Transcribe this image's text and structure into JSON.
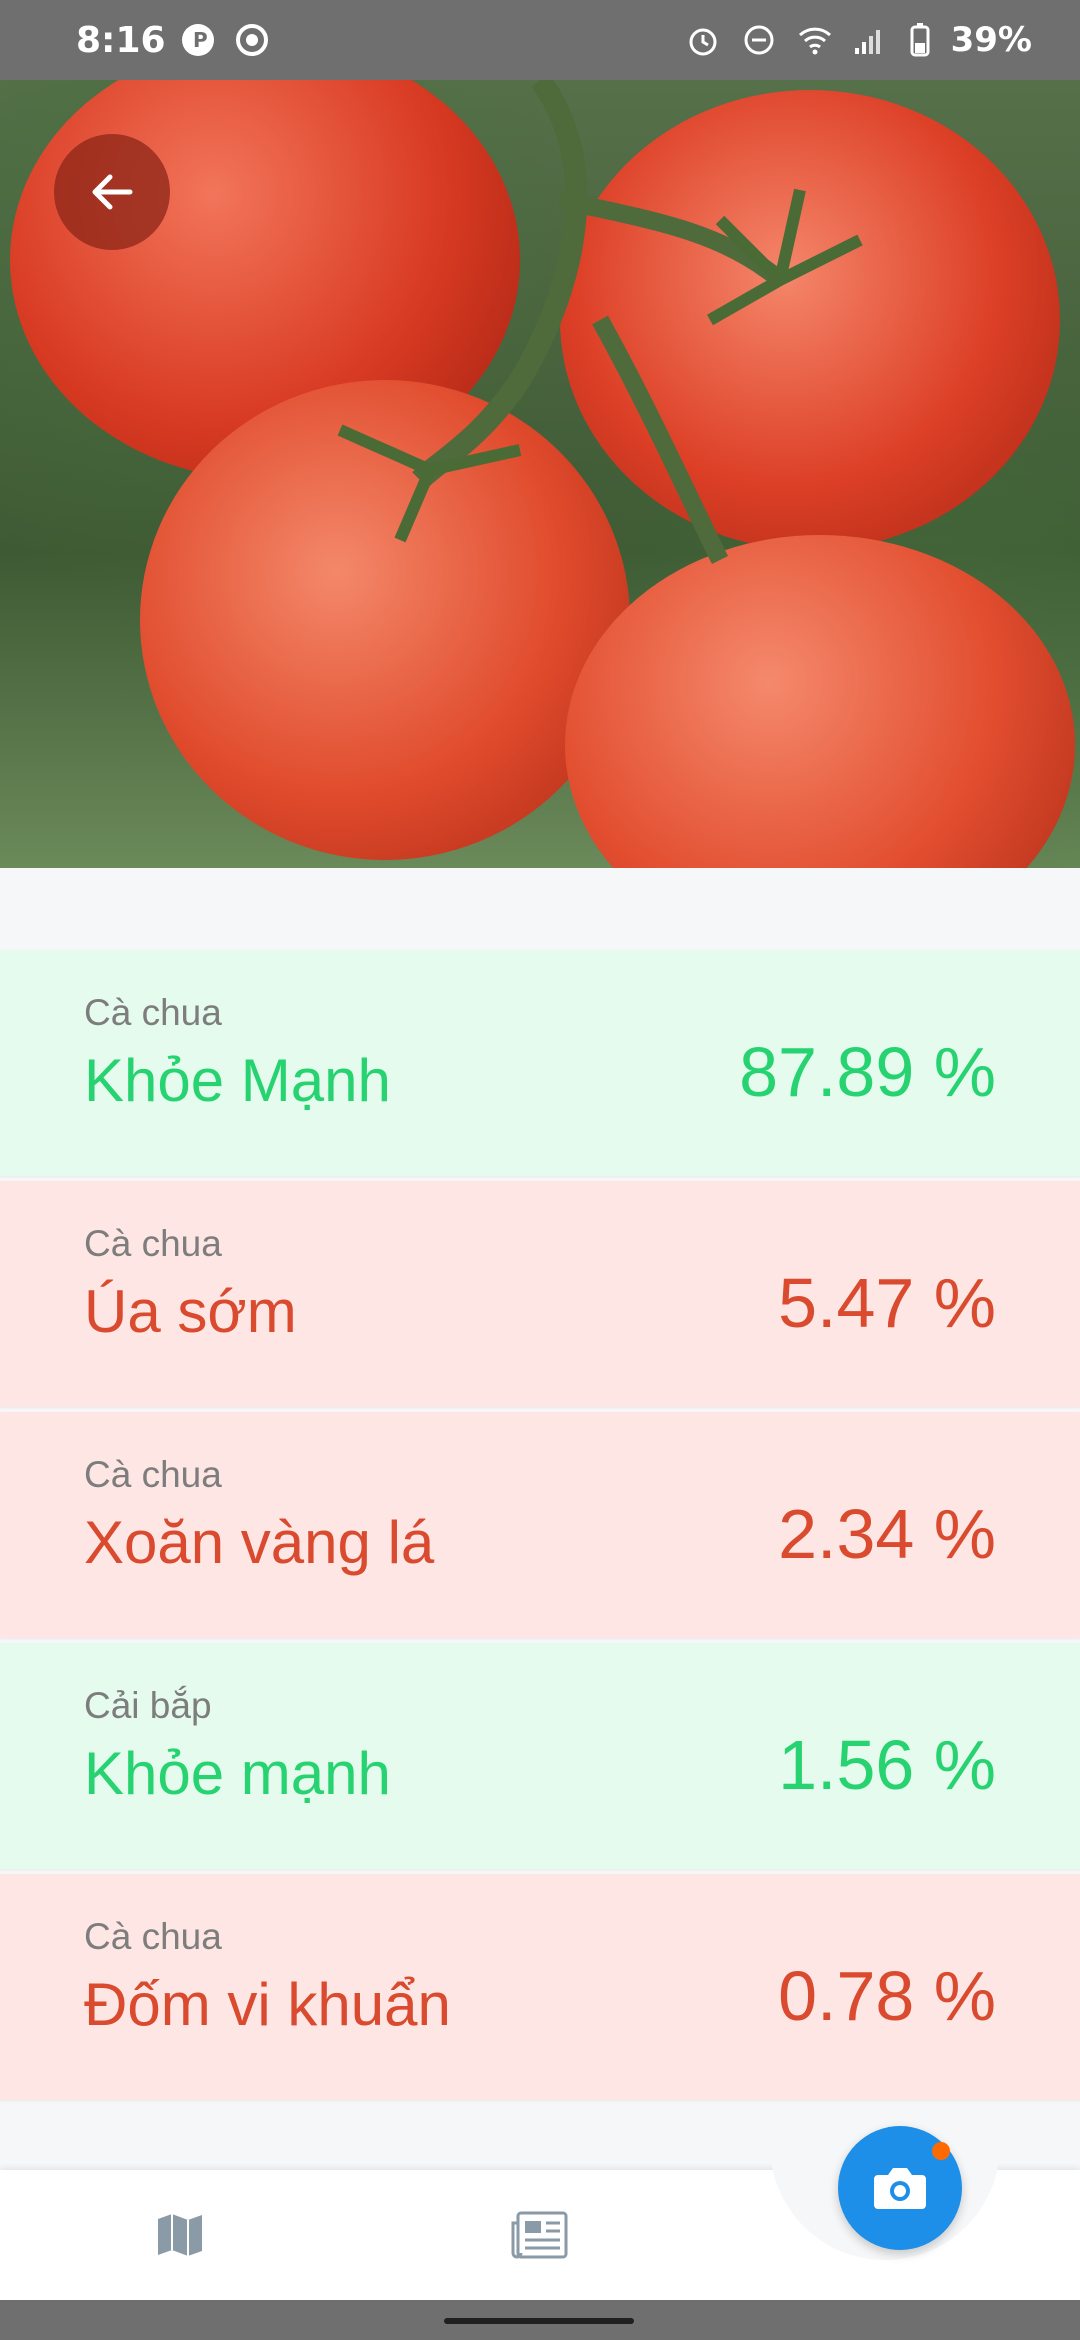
{
  "status_bar": {
    "time": "8:16",
    "battery": "39%"
  },
  "hero": {
    "image": "tomatoes-on-vine"
  },
  "results": [
    {
      "plant": "Cà chua",
      "label": "Khỏe Mạnh",
      "percent": "87.89 %",
      "status": "healthy"
    },
    {
      "plant": "Cà chua",
      "label": "Úa sớm",
      "percent": "5.47 %",
      "status": "disease"
    },
    {
      "plant": "Cà chua",
      "label": "Xoăn vàng lá",
      "percent": "2.34 %",
      "status": "disease"
    },
    {
      "plant": "Cải bắp",
      "label": "Khỏe mạnh",
      "percent": "1.56 %",
      "status": "healthy"
    },
    {
      "plant": "Cà chua",
      "label": "Đốm vi khuẩn",
      "percent": "0.78 %",
      "status": "disease"
    }
  ],
  "colors": {
    "healthy": "#26d370",
    "disease": "#d94a2e",
    "fab": "#1e8fe9"
  },
  "nav": {
    "items": [
      "map-icon",
      "news-icon"
    ],
    "fab_icon": "camera-icon"
  }
}
